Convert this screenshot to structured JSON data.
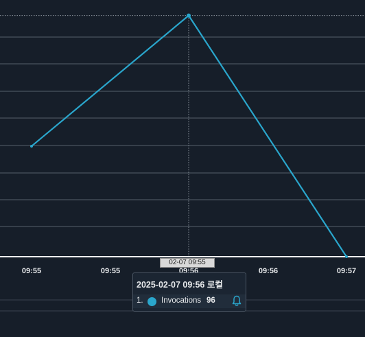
{
  "chart_data": {
    "type": "line",
    "x_tick_labels": [
      "09:55",
      "09:55",
      "09:56",
      "09:56",
      "09:57"
    ],
    "series": [
      {
        "name": "Invocations",
        "color": "#2aa6cc",
        "points": [
          {
            "x": "09:55",
            "y": 44
          },
          {
            "x": "09:56",
            "y": 96
          },
          {
            "x": "09:57",
            "y": 0
          }
        ]
      }
    ],
    "ylim": [
      0,
      100
    ],
    "grid": true,
    "cursor": {
      "x_label": "02-07 09:55",
      "tooltip": {
        "title": "2025-02-07 09:56 로컬",
        "rows": [
          {
            "index": "1.",
            "name": "Invocations",
            "value": "96",
            "icon": "bell-icon"
          }
        ]
      }
    }
  }
}
